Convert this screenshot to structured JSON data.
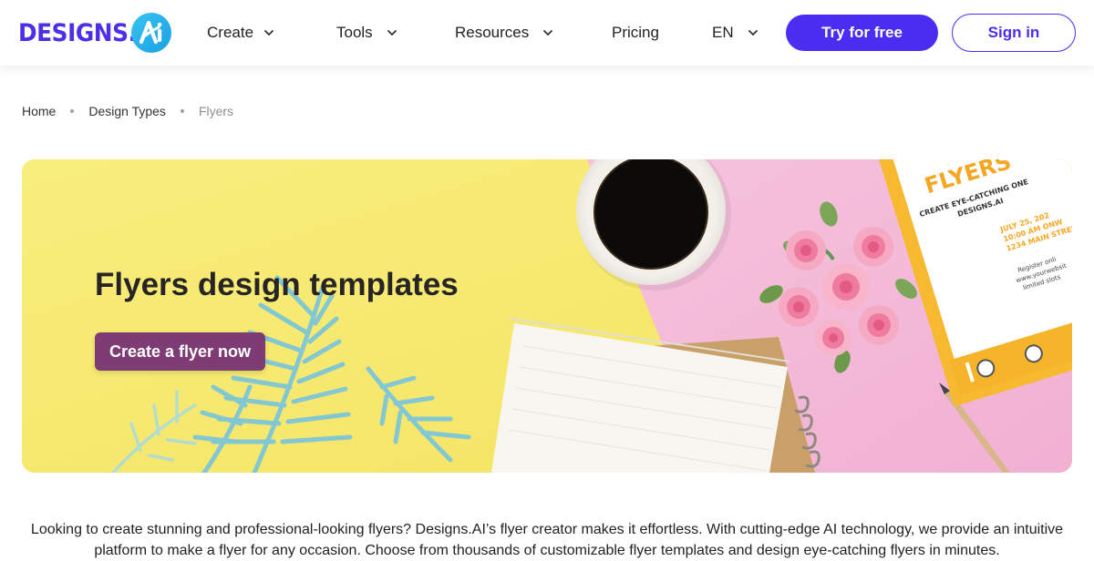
{
  "header": {
    "logo_text": "DESIGNS.",
    "nav": [
      {
        "label": "Create"
      },
      {
        "label": "Tools"
      },
      {
        "label": "Resources"
      },
      {
        "label": "Pricing"
      },
      {
        "label": "EN"
      }
    ],
    "try_label": "Try for free",
    "signin_label": "Sign in"
  },
  "breadcrumb": [
    "Home",
    "Design Types",
    "Flyers"
  ],
  "hero": {
    "title": "Flyers design templates",
    "cta_label": "Create a flyer now",
    "flyer_heading": "FLYERS",
    "flyer_sub": [
      "CREATE EYE-CATCHING ONE",
      "DESIGNS.AI"
    ],
    "flyer_details": [
      "JULY 25, 202",
      "10:00 AM ONW",
      "1234 MAIN STREE"
    ],
    "flyer_small": [
      "Register onli",
      "www.yourwebsit",
      "limited slots"
    ]
  },
  "intro": {
    "text": "Looking to create stunning and professional-looking flyers? Designs.AI’s flyer creator makes it effortless. With cutting-edge AI technology, we provide an intuitive platform to make a flyer for any occasion. Choose from thousands of customizable flyer templates and design eye-catching flyers in minutes."
  },
  "colors": {
    "brand": "#4a2df0",
    "cta": "#7d3c73",
    "hero_yellow": "#f7ea74",
    "hero_pink": "#f4b8d8"
  },
  "icons": [
    "chevron-down-icon",
    "ai-logo-badge"
  ]
}
